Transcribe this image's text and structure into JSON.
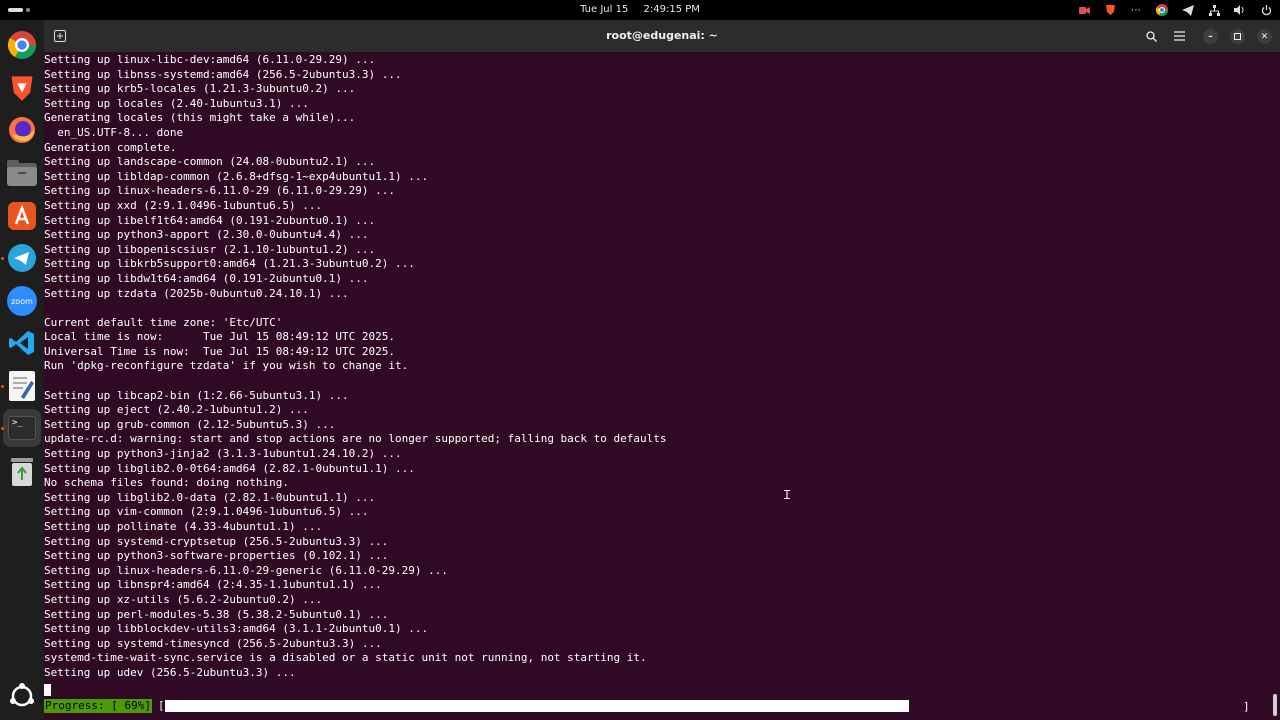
{
  "topbar": {
    "date": "Tue Jul 15",
    "time": "2:49:15 PM",
    "tray_icons": [
      "camera-icon",
      "brave-icon",
      "more-icon",
      "chrome-icon",
      "telegram-icon",
      "network-icon",
      "volume-icon",
      "power-icon"
    ]
  },
  "dock": {
    "apps": [
      "chrome",
      "brave",
      "firefox",
      "files",
      "app-center",
      "telegram",
      "zoom",
      "vscode",
      "text-editor",
      "terminal",
      "trash",
      "show-apps"
    ],
    "zoom_label": "zoom"
  },
  "window": {
    "title": "root@edugenai: ~"
  },
  "terminal": {
    "lines": [
      "Setting up linux-libc-dev:amd64 (6.11.0-29.29) ...",
      "Setting up libnss-systemd:amd64 (256.5-2ubuntu3.3) ...",
      "Setting up krb5-locales (1.21.3-3ubuntu0.2) ...",
      "Setting up locales (2.40-1ubuntu3.1) ...",
      "Generating locales (this might take a while)...",
      "  en_US.UTF-8... done",
      "Generation complete.",
      "Setting up landscape-common (24.08-0ubuntu2.1) ...",
      "Setting up libldap-common (2.6.8+dfsg-1~exp4ubuntu1.1) ...",
      "Setting up linux-headers-6.11.0-29 (6.11.0-29.29) ...",
      "Setting up xxd (2:9.1.0496-1ubuntu6.5) ...",
      "Setting up libelf1t64:amd64 (0.191-2ubuntu0.1) ...",
      "Setting up python3-apport (2.30.0-0ubuntu4.4) ...",
      "Setting up libopeniscsiusr (2.1.10-1ubuntu1.2) ...",
      "Setting up libkrb5support0:amd64 (1.21.3-3ubuntu0.2) ...",
      "Setting up libdw1t64:amd64 (0.191-2ubuntu0.1) ...",
      "Setting up tzdata (2025b-0ubuntu0.24.10.1) ...",
      "",
      "Current default time zone: 'Etc/UTC'",
      "Local time is now:      Tue Jul 15 08:49:12 UTC 2025.",
      "Universal Time is now:  Tue Jul 15 08:49:12 UTC 2025.",
      "Run 'dpkg-reconfigure tzdata' if you wish to change it.",
      "",
      "Setting up libcap2-bin (1:2.66-5ubuntu3.1) ...",
      "Setting up eject (2.40.2-1ubuntu1.2) ...",
      "Setting up grub-common (2.12-5ubuntu5.3) ...",
      "update-rc.d: warning: start and stop actions are no longer supported; falling back to defaults",
      "Setting up python3-jinja2 (3.1.3-1ubuntu1.24.10.2) ...",
      "Setting up libglib2.0-0t64:amd64 (2.82.1-0ubuntu1.1) ...",
      "No schema files found: doing nothing.",
      "Setting up libglib2.0-data (2.82.1-0ubuntu1.1) ...",
      "Setting up vim-common (2:9.1.0496-1ubuntu6.5) ...",
      "Setting up pollinate (4.33-4ubuntu1.1) ...",
      "Setting up systemd-cryptsetup (256.5-2ubuntu3.3) ...",
      "Setting up python3-software-properties (0.102.1) ...",
      "Setting up linux-headers-6.11.0-29-generic (6.11.0-29.29) ...",
      "Setting up libnspr4:amd64 (2:4.35-1.1ubuntu1.1) ...",
      "Setting up xz-utils (5.6.2-2ubuntu0.2) ...",
      "Setting up perl-modules-5.38 (5.38.2-5ubuntu0.1) ...",
      "Setting up libblockdev-utils3:amd64 (3.1.1-2ubuntu0.1) ...",
      "Setting up systemd-timesyncd (256.5-2ubuntu3.3) ...",
      "systemd-time-wait-sync.service is a disabled or a static unit not running, not starting it.",
      "Setting up udev (256.5-2ubuntu3.3) ..."
    ],
    "progress_label": "Progress: [ 69%]",
    "progress_open": "[",
    "progress_close": "]"
  }
}
